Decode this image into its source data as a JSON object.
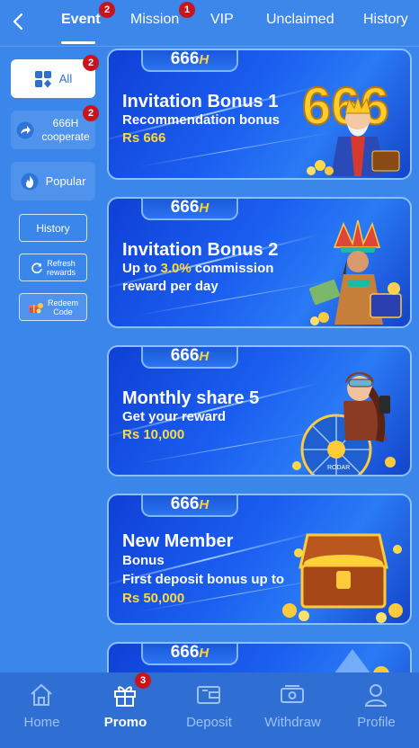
{
  "header": {
    "tabs": [
      {
        "label": "Event",
        "badge": "2"
      },
      {
        "label": "Mission",
        "badge": "1"
      },
      {
        "label": "VIP"
      },
      {
        "label": "Unclaimed"
      },
      {
        "label": "History"
      }
    ]
  },
  "sidebar": {
    "all": {
      "label": "All",
      "badge": "2"
    },
    "cooperate": {
      "line1": "666H",
      "line2": "cooperate",
      "badge": "2"
    },
    "popular": {
      "label": "Popular"
    },
    "history": {
      "label": "History"
    },
    "refresh": {
      "line1": "Refresh",
      "line2": "rewards"
    },
    "redeem": {
      "line1": "Redeem",
      "line2": "Code"
    }
  },
  "brand": {
    "num": "666",
    "h": "H"
  },
  "promos": [
    {
      "title": "Invitation Bonus 1",
      "line1": "Recommendation bonus",
      "line2": "Rs 666",
      "art_text": "666"
    },
    {
      "title": "Invitation Bonus 2",
      "line1_pre": "Up to ",
      "line1_hl": "3.0%",
      "line1_post": " commission",
      "line2": "reward per day"
    },
    {
      "title": "Monthly share 5",
      "line1": "Get your reward",
      "line2": "Rs 10,000",
      "art_text": "RODAR"
    },
    {
      "title": "New Member",
      "line1": "Bonus",
      "line2": "First deposit bonus up to",
      "line3": "Rs 50,000"
    }
  ],
  "bottom_nav": [
    {
      "label": "Home"
    },
    {
      "label": "Promo",
      "badge": "3"
    },
    {
      "label": "Deposit"
    },
    {
      "label": "Withdraw"
    },
    {
      "label": "Profile"
    }
  ],
  "colors": {
    "background": "#3a86ea",
    "accent_gold": "#ffd93a",
    "badge": "#c8151d",
    "nav_bar": "#2f6fd3"
  }
}
